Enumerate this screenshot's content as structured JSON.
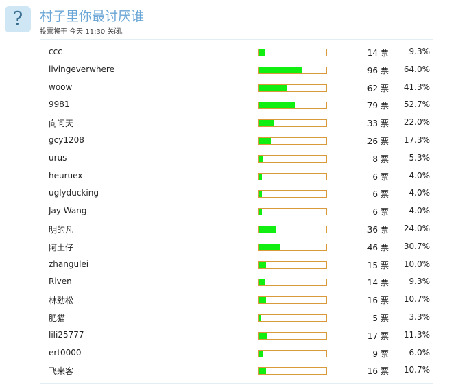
{
  "poll": {
    "icon": "question-mark-icon",
    "title": "村子里你最讨厌谁",
    "subtitle": "投票将于 今天 11:30 关闭。",
    "vote_unit": "票"
  },
  "colors": {
    "title": "#6aa6d6",
    "icon_bg": "#cfe6f5",
    "bar_fill": "#11ee11",
    "bar_border": "#d99a3c"
  },
  "options": [
    {
      "label": "ccc",
      "votes": "14",
      "percent": "9.3%",
      "fraction": 0.093
    },
    {
      "label": "livingeverwhere",
      "votes": "96",
      "percent": "64.0%",
      "fraction": 0.64
    },
    {
      "label": "woow",
      "votes": "62",
      "percent": "41.3%",
      "fraction": 0.413
    },
    {
      "label": "9981",
      "votes": "79",
      "percent": "52.7%",
      "fraction": 0.527
    },
    {
      "label": "向问天",
      "votes": "33",
      "percent": "22.0%",
      "fraction": 0.22
    },
    {
      "label": "gcy1208",
      "votes": "26",
      "percent": "17.3%",
      "fraction": 0.173
    },
    {
      "label": "urus",
      "votes": "8",
      "percent": "5.3%",
      "fraction": 0.053
    },
    {
      "label": "heuruex",
      "votes": "6",
      "percent": "4.0%",
      "fraction": 0.04
    },
    {
      "label": "uglyducking",
      "votes": "6",
      "percent": "4.0%",
      "fraction": 0.04
    },
    {
      "label": "Jay Wang",
      "votes": "6",
      "percent": "4.0%",
      "fraction": 0.04
    },
    {
      "label": "明的凡",
      "votes": "36",
      "percent": "24.0%",
      "fraction": 0.24
    },
    {
      "label": "阿土仔",
      "votes": "46",
      "percent": "30.7%",
      "fraction": 0.307
    },
    {
      "label": "zhangulei",
      "votes": "15",
      "percent": "10.0%",
      "fraction": 0.1
    },
    {
      "label": "Riven",
      "votes": "14",
      "percent": "9.3%",
      "fraction": 0.093
    },
    {
      "label": "林劲松",
      "votes": "16",
      "percent": "10.7%",
      "fraction": 0.107
    },
    {
      "label": "肥猫",
      "votes": "5",
      "percent": "3.3%",
      "fraction": 0.033
    },
    {
      "label": "lili25777",
      "votes": "17",
      "percent": "11.3%",
      "fraction": 0.113
    },
    {
      "label": "ert0000",
      "votes": "9",
      "percent": "6.0%",
      "fraction": 0.06
    },
    {
      "label": "飞来客",
      "votes": "16",
      "percent": "10.7%",
      "fraction": 0.107
    }
  ]
}
